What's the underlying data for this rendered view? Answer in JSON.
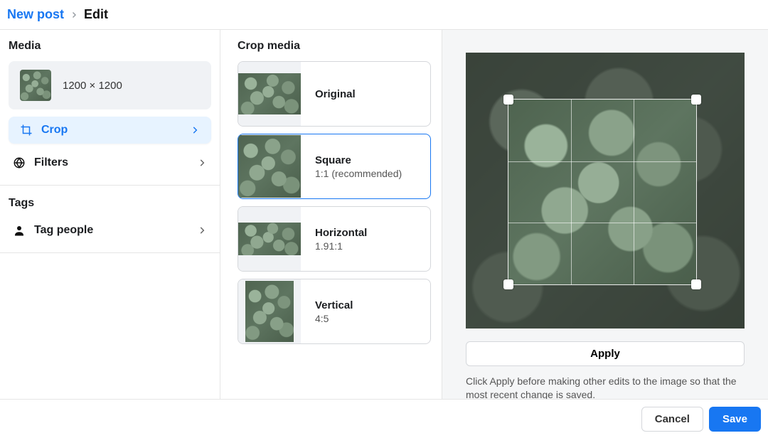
{
  "breadcrumb": {
    "parent": "New post",
    "current": "Edit"
  },
  "left": {
    "media_title": "Media",
    "media_dimensions": "1200 × 1200",
    "crop_label": "Crop",
    "filters_label": "Filters",
    "tags_title": "Tags",
    "tag_people_label": "Tag people"
  },
  "mid": {
    "title": "Crop media",
    "options": [
      {
        "name": "Original",
        "sub": ""
      },
      {
        "name": "Square",
        "sub": "1:1 (recommended)"
      },
      {
        "name": "Horizontal",
        "sub": "1.91:1"
      },
      {
        "name": "Vertical",
        "sub": "4:5"
      }
    ]
  },
  "right": {
    "apply_label": "Apply",
    "hint": "Click Apply before making other edits to the image so that the most recent change is saved."
  },
  "footer": {
    "cancel": "Cancel",
    "save": "Save"
  }
}
